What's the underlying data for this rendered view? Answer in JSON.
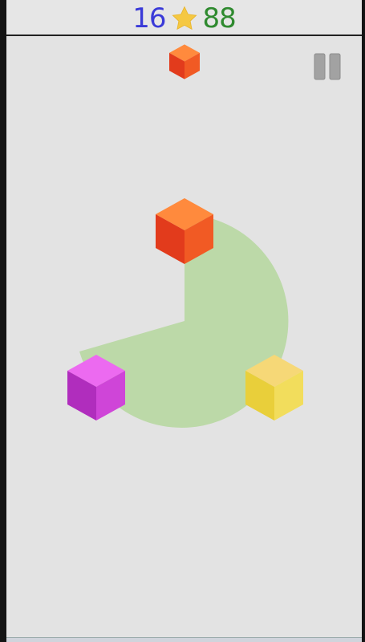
{
  "hud": {
    "left_score": "16",
    "right_score": "88",
    "star_icon": "star-icon",
    "pause_icon": "pause-icon"
  },
  "colors": {
    "left_score": "#3a3ad8",
    "right_score": "#2f8a2f",
    "star": "#f5c842",
    "wheel": "#bcd9a8",
    "orange_top": "#ff8a3d",
    "orange_left": "#e23b1c",
    "orange_right": "#f15a24",
    "magenta_top": "#ec6af0",
    "magenta_left": "#b02dbd",
    "magenta_right": "#cf45d8",
    "yellow_top": "#f6d877",
    "yellow_left": "#e9cf3a",
    "yellow_right": "#f2dd5c"
  },
  "game": {
    "falling_cube": "orange",
    "wheel_cubes": [
      "orange",
      "magenta",
      "yellow"
    ]
  }
}
